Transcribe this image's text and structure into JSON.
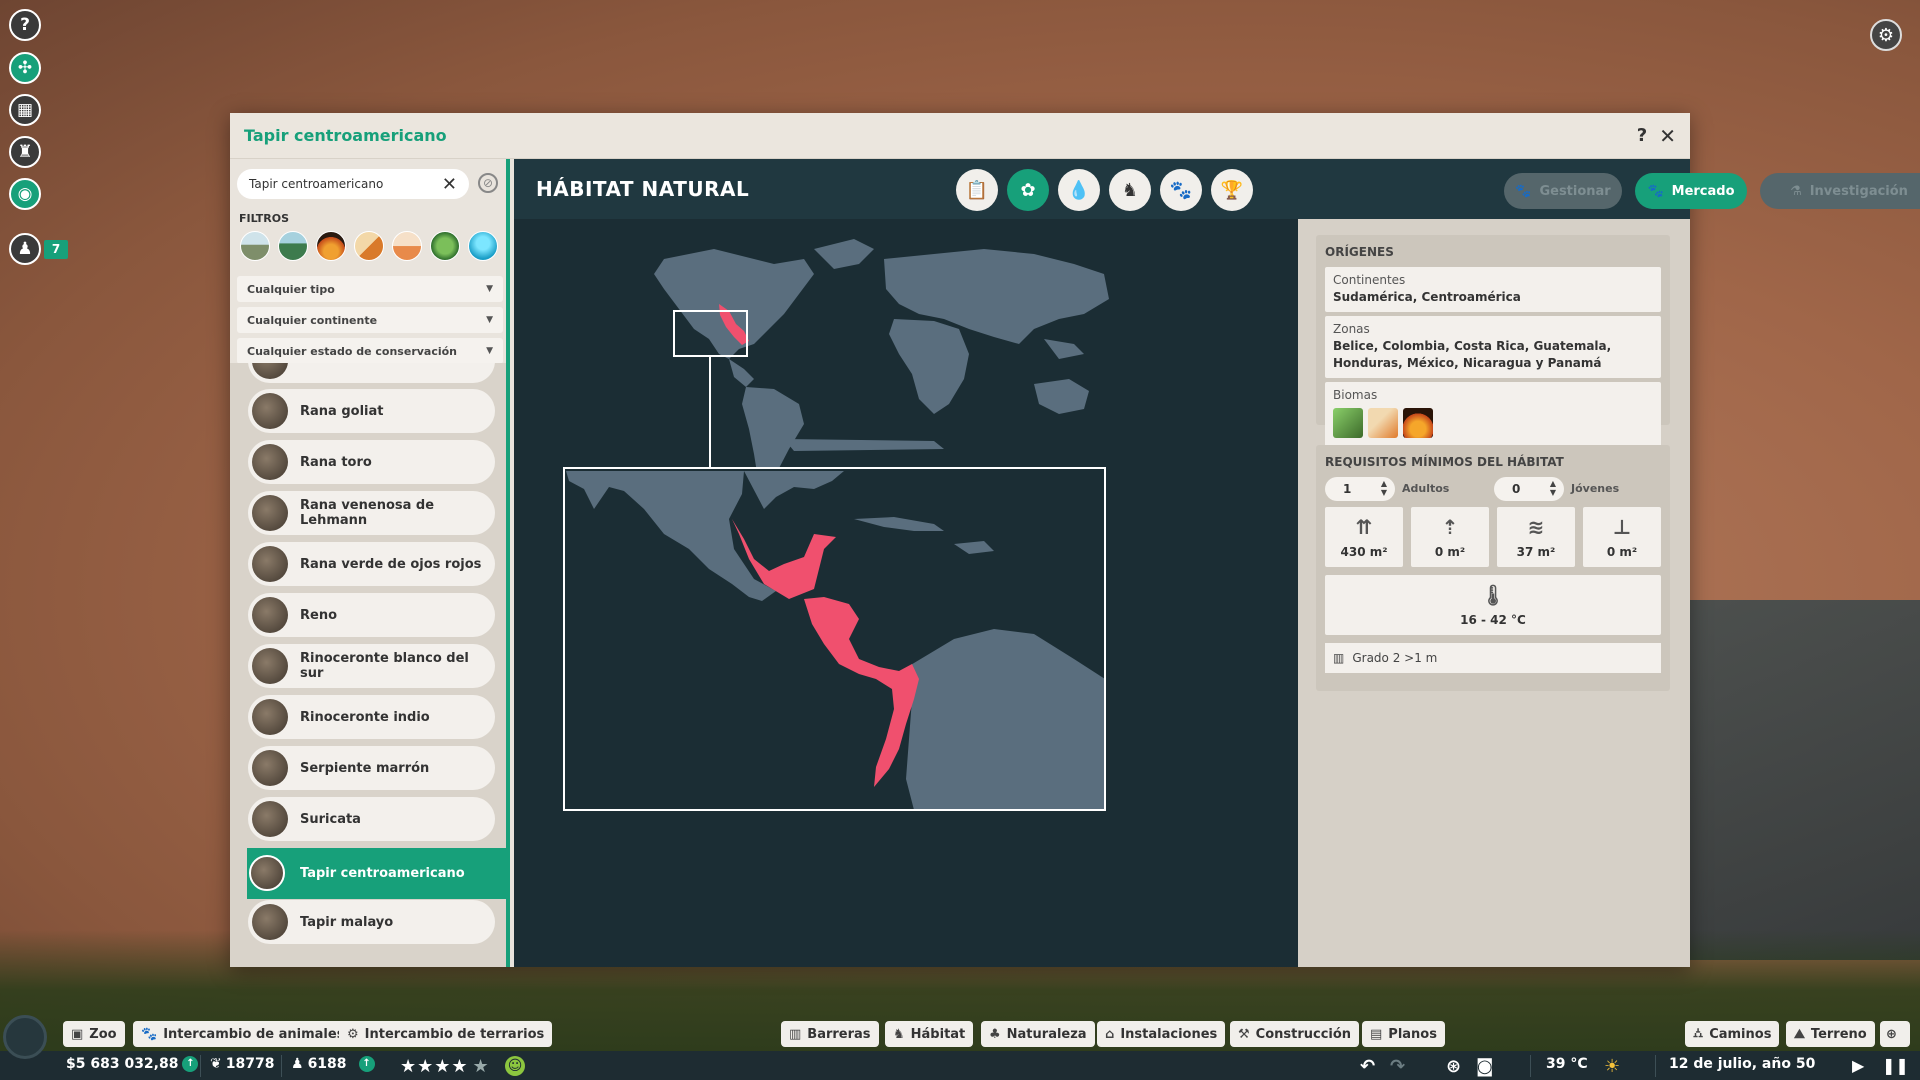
{
  "window": {
    "title": "Tapir centroamericano",
    "help": "?",
    "close": "✕"
  },
  "left_bar": {
    "badge": "7"
  },
  "left_panel": {
    "search_value": "Tapir centroamericano",
    "filters_label": "FILTROS",
    "dropdowns": [
      "Cualquier tipo",
      "Cualquier continente",
      "Cualquier estado de conservación"
    ],
    "items": [
      "Rana goliat",
      "Rana toro",
      "Rana venenosa de Lehmann",
      "Rana verde de ojos rojos",
      "Reno",
      "Rinoceronte blanco del sur",
      "Rinoceronte indio",
      "Serpiente marrón",
      "Suricata",
      "Tapir centroamericano",
      "Tapir malayo"
    ],
    "selected": "Tapir centroamericano"
  },
  "header": {
    "title": "HÁBITAT NATURAL",
    "buttons": {
      "manage": "Gestionar",
      "market": "Mercado",
      "research": "Investigación"
    }
  },
  "origins": {
    "heading": "ORÍGENES",
    "continents_label": "Continentes",
    "continents_value": "Sudamérica, Centroamérica",
    "zones_label": "Zonas",
    "zones_value_1": "Belice, Colombia, Costa Rica, Guatemala,",
    "zones_value_2": "Honduras, México, Nicaragua y Panamá",
    "biomes_label": "Biomas"
  },
  "requirements": {
    "heading": "REQUISITOS MÍNIMOS DEL HÁBITAT",
    "adults_value": "1",
    "adults_label": "Adultos",
    "young_value": "0",
    "young_label": "Jóvenes",
    "land": "430  m²",
    "climb": "0  m²",
    "water": "37  m²",
    "deep": "0  m²",
    "temperature": "16 - 42 °C",
    "barrier": "Grado 2 >1 m"
  },
  "bottom_bar": {
    "left_buttons": [
      "Zoo",
      "Intercambio de animales",
      "Intercambio de terrarios"
    ],
    "mid_buttons": [
      "Barreras",
      "Hábitat",
      "Naturaleza",
      "Instalaciones",
      "Construcción",
      "Planos"
    ],
    "right_buttons": [
      "Caminos",
      "Terreno"
    ],
    "money": "$5 683 032,88",
    "conservation": "18778",
    "guests": "6188",
    "temperature": "39 °C",
    "date": "12 de julio, año 50"
  },
  "colors": {
    "accent": "#17a07a",
    "range_highlight": "#f0506e",
    "map_land": "#5a6e7e",
    "map_sea": "#1b2d34"
  }
}
